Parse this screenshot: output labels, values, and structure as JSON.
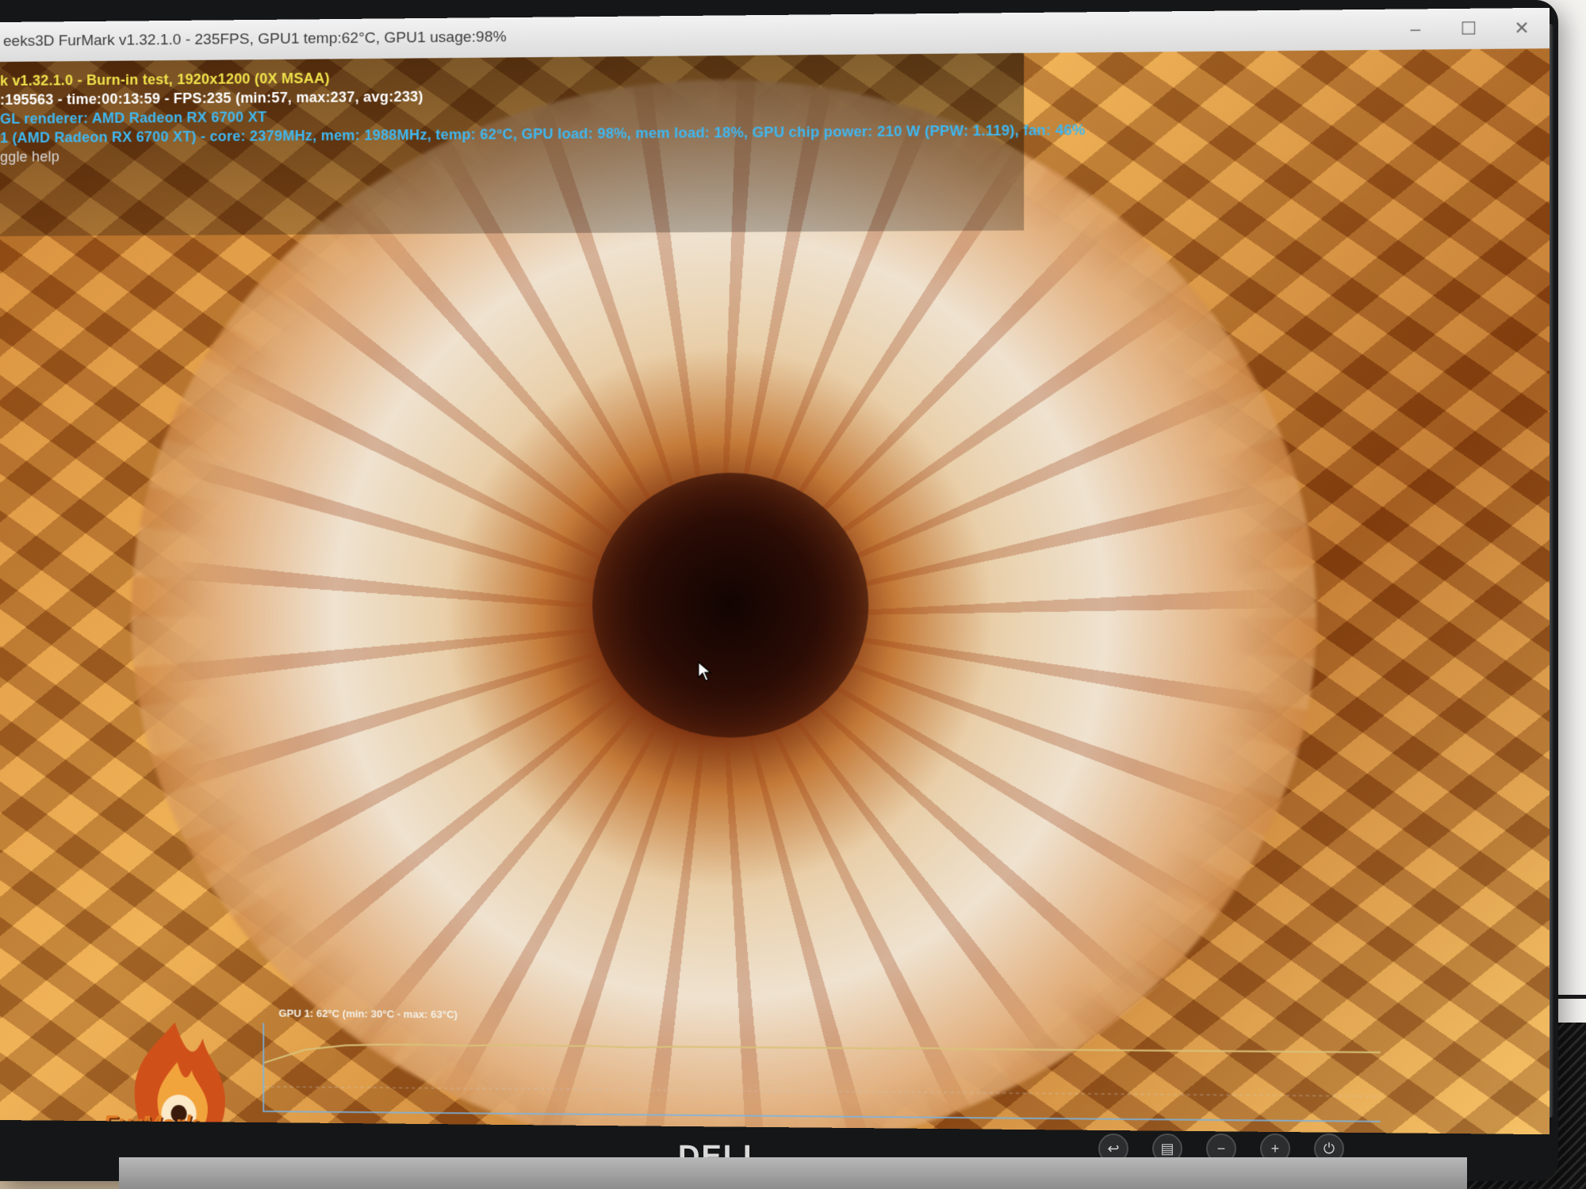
{
  "window": {
    "title": "eeks3D FurMark v1.32.1.0 - 235FPS, GPU1 temp:62°C, GPU1 usage:98%",
    "controls": [
      "minimize-icon",
      "maximize-icon",
      "close-icon"
    ]
  },
  "hud": {
    "line1": "k v1.32.1.0 - Burn-in test, 1920x1200 (0X MSAA)",
    "line2": ":195563 - time:00:13:59 - FPS:235 (min:57, max:237, avg:233)",
    "line3": "GL renderer: AMD Radeon RX 6700 XT",
    "line4": "1 (AMD Radeon RX 6700 XT) - core: 2379MHz, mem: 1988MHz, temp: 62°C, GPU load: 98%, mem load: 18%, GPU chip power: 210 W (PPW: 1.119), fan: 46%",
    "line5": "ggle help"
  },
  "graph": {
    "label": "GPU 1: 62°C (min: 30°C - max: 63°C)",
    "temperature_samples": [
      30,
      52,
      60,
      62,
      62,
      61,
      63,
      62,
      62,
      60,
      62,
      62,
      62,
      62,
      62,
      62,
      63,
      62,
      62,
      62,
      62,
      62,
      62,
      62,
      62,
      62,
      62,
      62
    ],
    "min_temp": 30,
    "max_temp": 63,
    "line_color": "#d9c27a"
  },
  "logo": {
    "text": "FurMark",
    "icon": "furmark-flame-logo-icon"
  },
  "monitor": {
    "brand": "DELL",
    "buttons": [
      "input-source-icon",
      "menu-icon",
      "minus-icon",
      "plus-icon",
      "power-icon"
    ]
  },
  "colors": {
    "hud_yellow": "#f0e24a",
    "hud_white": "#ffffff",
    "hud_cyan": "#3fb7f0",
    "hud_gray": "#d8d8d8"
  }
}
